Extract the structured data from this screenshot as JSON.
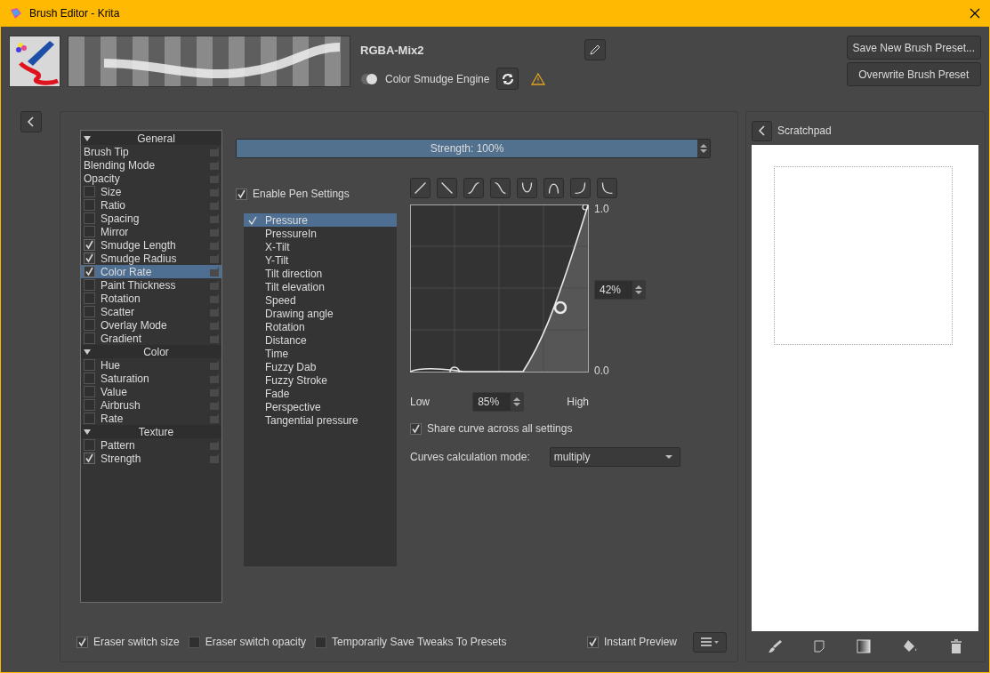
{
  "window": {
    "title": "Brush Editor - Krita"
  },
  "header": {
    "preset_name": "RGBA-Mix2",
    "engine_label": "Color Smudge Engine",
    "buttons": [
      "Save New Brush Preset...",
      "Overwrite Brush Preset"
    ]
  },
  "options": [
    {
      "title": "General",
      "expanded": true,
      "items": [
        {
          "label": "Brush Tip",
          "kind": "plain",
          "selected": false
        },
        {
          "label": "Blending Mode",
          "kind": "plain",
          "selected": false
        },
        {
          "label": "Opacity",
          "kind": "plain",
          "selected": false
        },
        {
          "label": "Size",
          "kind": "check",
          "checked": false,
          "selected": false
        },
        {
          "label": "Ratio",
          "kind": "check",
          "checked": false,
          "selected": false
        },
        {
          "label": "Spacing",
          "kind": "check",
          "checked": false,
          "selected": false
        },
        {
          "label": "Mirror",
          "kind": "check",
          "checked": false,
          "selected": false
        },
        {
          "label": "Smudge Length",
          "kind": "check",
          "checked": true,
          "selected": false
        },
        {
          "label": "Smudge Radius",
          "kind": "check",
          "checked": true,
          "selected": false
        },
        {
          "label": "Color Rate",
          "kind": "check",
          "checked": true,
          "selected": true
        },
        {
          "label": "Paint Thickness",
          "kind": "check",
          "checked": false,
          "selected": false
        },
        {
          "label": "Rotation",
          "kind": "check",
          "checked": false,
          "selected": false
        },
        {
          "label": "Scatter",
          "kind": "check",
          "checked": false,
          "selected": false
        },
        {
          "label": "Overlay Mode",
          "kind": "check",
          "checked": false,
          "selected": false
        },
        {
          "label": "Gradient",
          "kind": "check",
          "checked": false,
          "selected": false
        }
      ]
    },
    {
      "title": "Color",
      "expanded": true,
      "items": [
        {
          "label": "Hue",
          "kind": "check",
          "checked": false,
          "selected": false
        },
        {
          "label": "Saturation",
          "kind": "check",
          "checked": false,
          "selected": false
        },
        {
          "label": "Value",
          "kind": "check",
          "checked": false,
          "selected": false
        },
        {
          "label": "Airbrush",
          "kind": "check",
          "checked": false,
          "selected": false
        },
        {
          "label": "Rate",
          "kind": "check",
          "checked": false,
          "selected": false
        }
      ]
    },
    {
      "title": "Texture",
      "expanded": true,
      "items": [
        {
          "label": "Pattern",
          "kind": "check",
          "checked": false,
          "selected": false
        },
        {
          "label": "Strength",
          "kind": "check",
          "checked": true,
          "selected": false
        }
      ]
    }
  ],
  "strength": {
    "label": "Strength: 100%",
    "level": 1
  },
  "pen_settings": {
    "label": "Enable Pen Settings",
    "checked": true
  },
  "sensors": [
    {
      "label": "Pressure",
      "checked": true,
      "selected": true
    },
    {
      "label": "PressureIn",
      "checked": false,
      "selected": false
    },
    {
      "label": "X-Tilt",
      "checked": false,
      "selected": false
    },
    {
      "label": "Y-Tilt",
      "checked": false,
      "selected": false
    },
    {
      "label": "Tilt direction",
      "checked": false,
      "selected": false
    },
    {
      "label": "Tilt elevation",
      "checked": false,
      "selected": false
    },
    {
      "label": "Speed",
      "checked": false,
      "selected": false
    },
    {
      "label": "Drawing angle",
      "checked": false,
      "selected": false
    },
    {
      "label": "Rotation",
      "checked": false,
      "selected": false
    },
    {
      "label": "Distance",
      "checked": false,
      "selected": false
    },
    {
      "label": "Time",
      "checked": false,
      "selected": false
    },
    {
      "label": "Fuzzy Dab",
      "checked": false,
      "selected": false
    },
    {
      "label": "Fuzzy Stroke",
      "checked": false,
      "selected": false
    },
    {
      "label": "Fade",
      "checked": false,
      "selected": false
    },
    {
      "label": "Perspective",
      "checked": false,
      "selected": false
    },
    {
      "label": "Tangential pressure",
      "checked": false,
      "selected": false
    }
  ],
  "curve": {
    "y_max": "1.0",
    "y_min": "0.0",
    "point_value": "42%",
    "low_label": "Low",
    "high_label": "High",
    "range_value": "85%"
  },
  "share_curve": {
    "label": "Share curve across all settings",
    "checked": true
  },
  "calc_mode": {
    "label": "Curves calculation mode:",
    "value": "multiply"
  },
  "bottom_options": [
    {
      "label": "Eraser switch size",
      "checked": true
    },
    {
      "label": "Eraser switch opacity",
      "checked": false
    },
    {
      "label": "Temporarily Save Tweaks To Presets",
      "checked": false
    }
  ],
  "instant_preview": {
    "label": "Instant Preview",
    "checked": true
  },
  "scratchpad": {
    "title": "Scratchpad"
  }
}
